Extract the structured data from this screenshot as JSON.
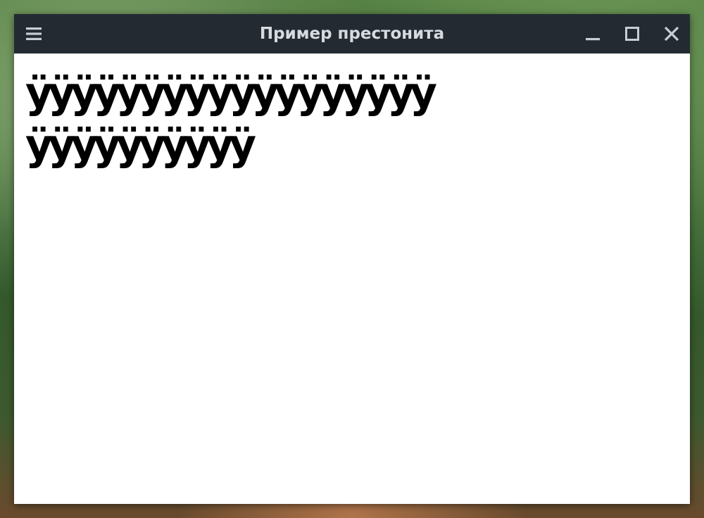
{
  "window": {
    "title": "Пример престонита"
  },
  "titlebar": {
    "menu_icon": "hamburger-menu-icon",
    "minimize_icon": "minimize-icon",
    "maximize_icon": "maximize-icon",
    "close_icon": "close-icon",
    "bar_color": "#232a31",
    "title_color": "#d7dbe0"
  },
  "content": {
    "lines": [
      "ӱӱӱӱӱӱӱӱӱӱӱӱӱӱӱӱӱӱ",
      "ӱӱӱӱӱӱӱӱӱӱ"
    ]
  }
}
